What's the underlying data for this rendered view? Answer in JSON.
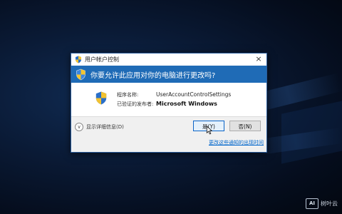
{
  "titlebar": {
    "title": "用户帐户控制",
    "close_glyph": "×"
  },
  "banner": {
    "question": "你要允许此应用对你的电脑进行更改吗?"
  },
  "program": {
    "name_label": "程序名称:",
    "name_value": "UserAccountControlSettings",
    "publisher_label": "已验证的发布者:",
    "publisher_value": "Microsoft Windows"
  },
  "footer": {
    "details_label": "显示详细信息(D)",
    "yes_label": "是(Y)",
    "no_label": "否(N)",
    "change_link": "更改这些通知的出现时间"
  },
  "watermark": {
    "badge": "AI",
    "text": "树叶云"
  },
  "icons": {
    "title_icon": "uac-shield-icon",
    "banner_icon": "uac-shield-icon",
    "program_icon": "uac-shield-icon",
    "details_icon": "chevron-down-icon",
    "cursor": "mouse-cursor-icon"
  },
  "colors": {
    "banner_bg": "#1f6bb6",
    "link": "#0066cc",
    "default_button_border": "#0a64c8"
  }
}
